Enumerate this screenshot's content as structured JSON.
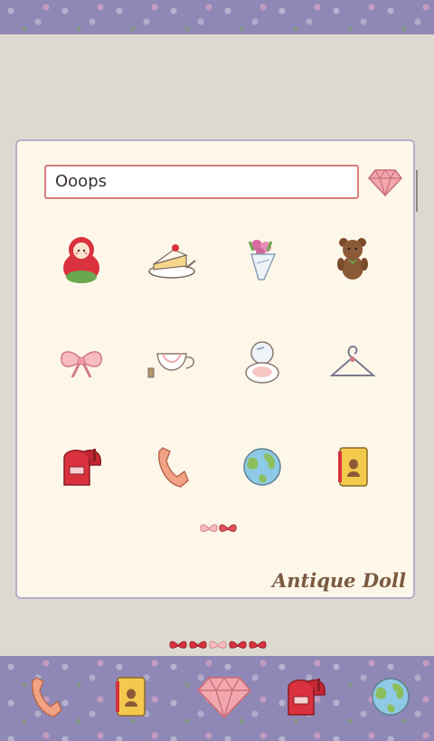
{
  "search": {
    "value": "Ooops"
  },
  "brand": {
    "label": "Antique Doll"
  },
  "grid_icons": [
    "matryoshka-doll-icon",
    "cake-icon",
    "bouquet-icon",
    "teddy-bear-icon",
    "bow-icon",
    "perfume-bottle-icon",
    "compact-mirror-icon",
    "hanger-icon",
    "mailbox-icon",
    "phone-icon",
    "globe-icon",
    "address-book-icon"
  ],
  "dock_icons": [
    "phone-icon",
    "address-book-icon",
    "diamond-icon",
    "mailbox-icon",
    "globe-icon"
  ],
  "colors": {
    "accent": "#d87c80",
    "band": "#8f88b6",
    "card": "#fdf7ea"
  }
}
